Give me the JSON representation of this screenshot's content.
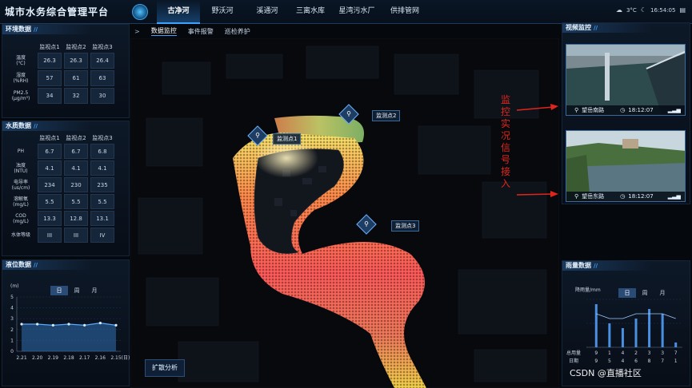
{
  "header": {
    "app_title": "城市水务综合管理平台",
    "nav_tabs": [
      {
        "label": "古净河",
        "active": true
      },
      {
        "label": "野沃河",
        "active": false
      },
      {
        "label": "溪通河",
        "active": false
      },
      {
        "label": "三离水库",
        "active": false
      },
      {
        "label": "星湾污水厂",
        "active": false
      },
      {
        "label": "供排管网",
        "active": false
      }
    ],
    "status": {
      "weather": "3°C",
      "time": "16:54:05"
    }
  },
  "subnav": {
    "arrow": ">",
    "items": [
      {
        "label": "数据监控",
        "active": true
      },
      {
        "label": "事件报警",
        "active": false
      },
      {
        "label": "巡检养护",
        "active": false
      }
    ]
  },
  "env_panel": {
    "title": "环境数据",
    "columns": [
      "监视点1",
      "监视点2",
      "监视点3"
    ],
    "rows": [
      {
        "label": "温度",
        "unit": "(℃)",
        "values": [
          "26.3",
          "26.3",
          "26.4"
        ]
      },
      {
        "label": "湿度",
        "unit": "(%RH)",
        "values": [
          "57",
          "61",
          "63"
        ]
      },
      {
        "label": "PM2.5",
        "unit": "(μg/m³)",
        "values": [
          "34",
          "32",
          "30"
        ]
      }
    ]
  },
  "water_panel": {
    "title": "水质数据",
    "columns": [
      "监视点1",
      "监视点2",
      "监视点3"
    ],
    "rows": [
      {
        "label": "PH",
        "unit": "",
        "values": [
          "6.7",
          "6.7",
          "6.8"
        ]
      },
      {
        "label": "浊度",
        "unit": "(NTU)",
        "values": [
          "4.1",
          "4.1",
          "4.1"
        ]
      },
      {
        "label": "电导率",
        "unit": "(us/cm)",
        "values": [
          "234",
          "230",
          "235"
        ]
      },
      {
        "label": "溶解氧",
        "unit": "(mg/L)",
        "values": [
          "5.5",
          "5.5",
          "5.5"
        ]
      },
      {
        "label": "COD",
        "unit": "(mg/L)",
        "values": [
          "13.3",
          "12.8",
          "13.1"
        ]
      },
      {
        "label": "水体等级",
        "unit": "",
        "values": [
          "III",
          "III",
          "IV"
        ]
      }
    ]
  },
  "level_panel": {
    "title": "液位数据",
    "tabs": [
      {
        "label": "日",
        "active": true
      },
      {
        "label": "周",
        "active": false
      },
      {
        "label": "月",
        "active": false
      }
    ]
  },
  "map": {
    "markers": [
      {
        "label": "监测点1"
      },
      {
        "label": "监测点2"
      },
      {
        "label": "监测点3"
      }
    ],
    "expand_button": "扩散分析"
  },
  "video_panel": {
    "title": "视频监控",
    "cameras": [
      {
        "location": "望岳南路",
        "time": "18:12:07"
      },
      {
        "location": "望岳东路",
        "time": "18:12:07"
      }
    ]
  },
  "rain_panel": {
    "title": "雨量数据",
    "tabs": [
      {
        "label": "日",
        "active": true
      },
      {
        "label": "周",
        "active": false
      },
      {
        "label": "月",
        "active": false
      }
    ]
  },
  "annotation": {
    "text": "监控实况信号接入"
  },
  "watermark": "CSDN @直播社区",
  "chart_data": [
    {
      "type": "line",
      "title": "液位数据",
      "ylabel": "(m)",
      "xlabel": "(日)",
      "x": [
        "2.21",
        "2.20",
        "2.19",
        "2.18",
        "2.17",
        "2.16",
        "2.15"
      ],
      "ylim": [
        0,
        5
      ],
      "yticks": [
        0,
        1,
        2,
        3,
        4,
        5
      ],
      "series": [
        {
          "values": [
            2.5,
            2.5,
            2.4,
            2.5,
            2.4,
            2.6,
            2.4
          ]
        }
      ],
      "colors": {
        "line": "#5aa8ff",
        "area": "#2f6fb3"
      }
    },
    {
      "type": "bar",
      "title": "雨量数据",
      "ylabel": "降雨量/mm",
      "categories": [
        "9",
        "5",
        "4",
        "6",
        "8",
        "7",
        "1"
      ],
      "category_label": "日期",
      "row_label": "总用量",
      "totals": [
        "9",
        "1",
        "4",
        "2",
        "3",
        "3",
        "7"
      ],
      "values": [
        9,
        5,
        4,
        6,
        8,
        7,
        1
      ],
      "line_values": [
        7,
        6,
        6,
        7,
        7,
        7,
        6
      ],
      "colors": {
        "bar": "#4a90e2",
        "line": "#9fcbff"
      }
    }
  ]
}
